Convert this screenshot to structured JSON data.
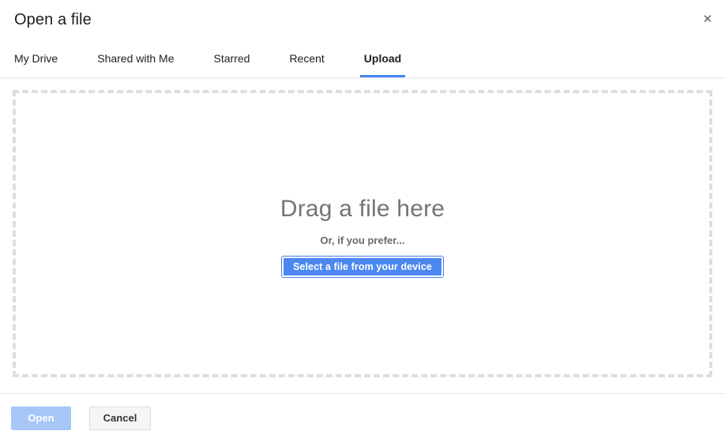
{
  "dialog": {
    "title": "Open a file",
    "close_icon": "close-icon",
    "close_glyph": "✕"
  },
  "tabs": [
    {
      "label": "My Drive",
      "active": false
    },
    {
      "label": "Shared with Me",
      "active": false
    },
    {
      "label": "Starred",
      "active": false
    },
    {
      "label": "Recent",
      "active": false
    },
    {
      "label": "Upload",
      "active": true
    }
  ],
  "upload": {
    "heading": "Drag a file here",
    "subtext": "Or, if you prefer...",
    "select_button_label": "Select a file from your device"
  },
  "footer": {
    "open_label": "Open",
    "cancel_label": "Cancel"
  },
  "colors": {
    "accent_blue": "#4285f4",
    "button_blue": "#4b88f2",
    "disabled_blue": "#a6c6f7",
    "dashed_border": "#dedede",
    "heading_gray": "#757575",
    "subtext_gray": "#666a6e",
    "secondary_bg": "#f5f5f5"
  }
}
